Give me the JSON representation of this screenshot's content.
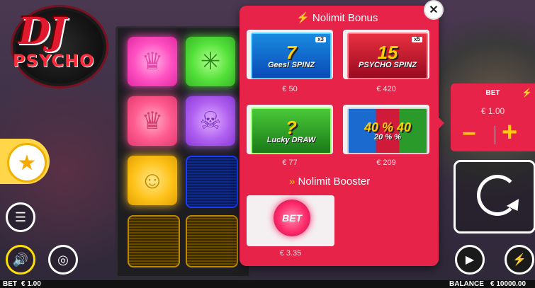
{
  "logo": {
    "line1": "DJ",
    "line2": "PSYCHO"
  },
  "reels": {
    "tiles": [
      {
        "color": "pink",
        "icon": "crown-icon",
        "glyph": "♛"
      },
      {
        "color": "green",
        "icon": "leaf-icon",
        "glyph": "✳"
      },
      {
        "color": "red",
        "icon": "crown-icon",
        "glyph": "♛"
      },
      {
        "color": "purple",
        "icon": "skull-icon",
        "glyph": "☠"
      },
      {
        "color": "yellow",
        "icon": "smiley-icon",
        "glyph": "☺"
      },
      {
        "color": "blue",
        "icon": "blank-icon",
        "glyph": ""
      },
      {
        "color": "orange",
        "icon": "blank-icon",
        "glyph": ""
      },
      {
        "color": "orange",
        "icon": "blank-icon",
        "glyph": ""
      }
    ]
  },
  "nolimit_bonus": {
    "title": "Nolimit Bonus",
    "items": [
      {
        "main": "7",
        "sub": "Gees! SPINZ",
        "badge": "x3",
        "price": "€ 50"
      },
      {
        "main": "15",
        "sub": "PSYCHO SPINZ",
        "badge": "x5",
        "price": "€ 420"
      },
      {
        "main": "?",
        "sub": "Lucky DRAW",
        "badge": "",
        "price": "€ 77"
      },
      {
        "main": "40 % 40",
        "sub": "20 % %",
        "badge": "",
        "price": "€ 209"
      }
    ]
  },
  "nolimit_booster": {
    "title": "Nolimit Booster",
    "item": {
      "label": "BET",
      "price": "€ 3.35"
    }
  },
  "bet_panel": {
    "title": "BET",
    "value": "€ 1.00",
    "minus": "−",
    "plus": "+"
  },
  "bottom_bar": {
    "bet_label": "BET",
    "bet_value": "€ 1.00",
    "balance_label": "BALANCE",
    "balance_value": "€ 10000.00"
  },
  "colors": {
    "accent": "#e8234a",
    "highlight": "#ffd000"
  }
}
